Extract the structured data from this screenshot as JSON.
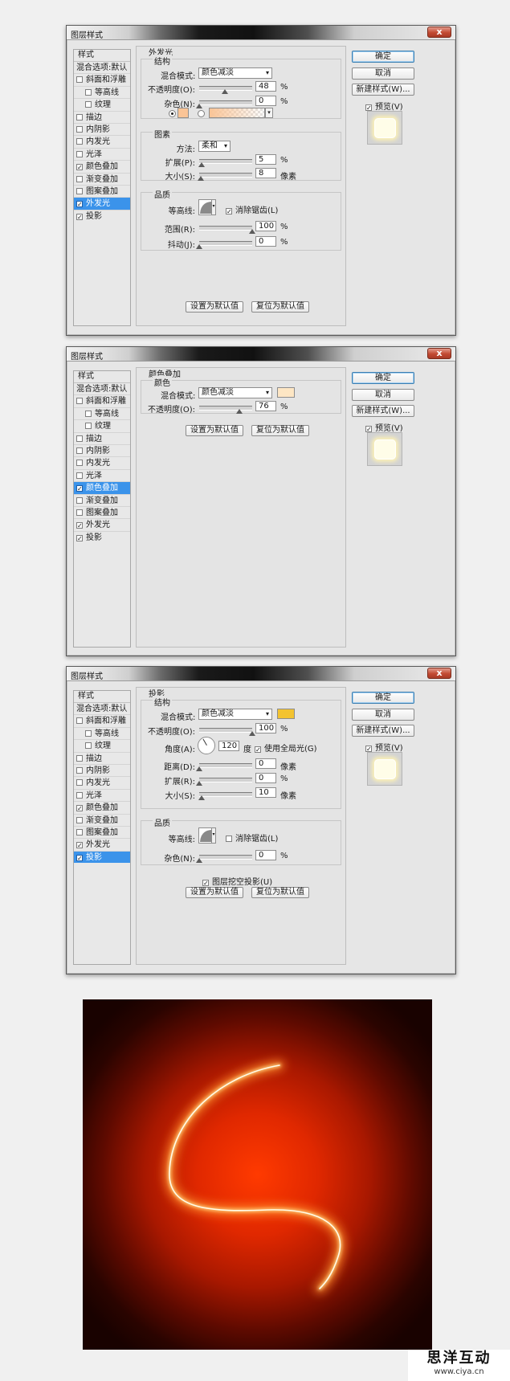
{
  "dialogs": [
    {
      "title": "图层样式",
      "close_label": "x",
      "styles": {
        "header": "样式",
        "blend_options": "混合选项:默认",
        "items": [
          {
            "label": "斜面和浮雕",
            "checked": false
          },
          {
            "label": "等高线",
            "checked": false,
            "sub": true
          },
          {
            "label": "纹理",
            "checked": false,
            "sub": true
          },
          {
            "label": "描边",
            "checked": false
          },
          {
            "label": "内阴影",
            "checked": false
          },
          {
            "label": "内发光",
            "checked": false
          },
          {
            "label": "光泽",
            "checked": false
          },
          {
            "label": "颜色叠加",
            "checked": true
          },
          {
            "label": "渐变叠加",
            "checked": false
          },
          {
            "label": "图案叠加",
            "checked": false
          },
          {
            "label": "外发光",
            "checked": true,
            "selected": true
          },
          {
            "label": "投影",
            "checked": true
          }
        ]
      },
      "section_title": "外发光",
      "structure": {
        "title": "结构",
        "blend_mode_label": "混合模式:",
        "blend_mode": "颜色减淡",
        "opacity_label": "不透明度(O):",
        "opacity": "48",
        "noise_label": "杂色(N):",
        "noise": "0",
        "percent": "%",
        "color": "#fac496"
      },
      "elements": {
        "title": "图素",
        "method_label": "方法:",
        "method": "柔和",
        "spread_label": "扩展(P):",
        "spread": "5",
        "size_label": "大小(S):",
        "size": "8",
        "percent": "%",
        "px": "像素"
      },
      "quality": {
        "title": "品质",
        "contour_label": "等高线:",
        "antialias_label": "消除锯齿(L)",
        "antialias": true,
        "range_label": "范围(R):",
        "range": "100",
        "jitter_label": "抖动(J):",
        "jitter": "0",
        "percent": "%"
      },
      "buttons": {
        "make_default": "设置为默认值",
        "reset_default": "复位为默认值",
        "ok": "确定",
        "cancel": "取消",
        "new_style": "新建样式(W)...",
        "preview": "预览(V)"
      }
    },
    {
      "title": "图层样式",
      "close_label": "x",
      "styles": {
        "header": "样式",
        "blend_options": "混合选项:默认",
        "items": [
          {
            "label": "斜面和浮雕",
            "checked": false
          },
          {
            "label": "等高线",
            "checked": false,
            "sub": true
          },
          {
            "label": "纹理",
            "checked": false,
            "sub": true
          },
          {
            "label": "描边",
            "checked": false
          },
          {
            "label": "内阴影",
            "checked": false
          },
          {
            "label": "内发光",
            "checked": false
          },
          {
            "label": "光泽",
            "checked": false
          },
          {
            "label": "颜色叠加",
            "checked": true,
            "selected": true
          },
          {
            "label": "渐变叠加",
            "checked": false
          },
          {
            "label": "图案叠加",
            "checked": false
          },
          {
            "label": "外发光",
            "checked": true
          },
          {
            "label": "投影",
            "checked": true
          }
        ]
      },
      "section_title": "颜色叠加",
      "color": {
        "title": "颜色",
        "blend_mode_label": "混合模式:",
        "blend_mode": "颜色减淡",
        "opacity_label": "不透明度(O):",
        "opacity": "76",
        "percent": "%",
        "color": "#fde6c4"
      },
      "buttons": {
        "make_default": "设置为默认值",
        "reset_default": "复位为默认值",
        "ok": "确定",
        "cancel": "取消",
        "new_style": "新建样式(W)...",
        "preview": "预览(V)"
      }
    },
    {
      "title": "图层样式",
      "close_label": "x",
      "styles": {
        "header": "样式",
        "blend_options": "混合选项:默认",
        "items": [
          {
            "label": "斜面和浮雕",
            "checked": false
          },
          {
            "label": "等高线",
            "checked": false,
            "sub": true
          },
          {
            "label": "纹理",
            "checked": false,
            "sub": true
          },
          {
            "label": "描边",
            "checked": false
          },
          {
            "label": "内阴影",
            "checked": false
          },
          {
            "label": "内发光",
            "checked": false
          },
          {
            "label": "光泽",
            "checked": false
          },
          {
            "label": "颜色叠加",
            "checked": true
          },
          {
            "label": "渐变叠加",
            "checked": false
          },
          {
            "label": "图案叠加",
            "checked": false
          },
          {
            "label": "外发光",
            "checked": true
          },
          {
            "label": "投影",
            "checked": true,
            "selected": true
          }
        ]
      },
      "section_title": "投影",
      "structure": {
        "title": "结构",
        "blend_mode_label": "混合模式:",
        "blend_mode": "颜色减淡",
        "opacity_label": "不透明度(O):",
        "opacity": "100",
        "angle_label": "角度(A):",
        "angle": "120",
        "degree": "度",
        "global_light_label": "使用全局光(G)",
        "global_light": true,
        "distance_label": "距离(D):",
        "distance": "0",
        "spread_label": "扩展(R):",
        "spread": "0",
        "size_label": "大小(S):",
        "size": "10",
        "percent": "%",
        "px": "像素",
        "color": "#f3c330"
      },
      "quality": {
        "title": "品质",
        "contour_label": "等高线:",
        "antialias_label": "消除锯齿(L)",
        "antialias": false,
        "noise_label": "杂色(N):",
        "noise": "0",
        "percent": "%"
      },
      "knockout_label": "图层挖空投影(U)",
      "knockout": true,
      "buttons": {
        "make_default": "设置为默认值",
        "reset_default": "复位为默认值",
        "ok": "确定",
        "cancel": "取消",
        "new_style": "新建样式(W)...",
        "preview": "预览(V)"
      }
    }
  ],
  "watermark": {
    "name": "思洋互动",
    "url": "www.ciya.cn"
  }
}
